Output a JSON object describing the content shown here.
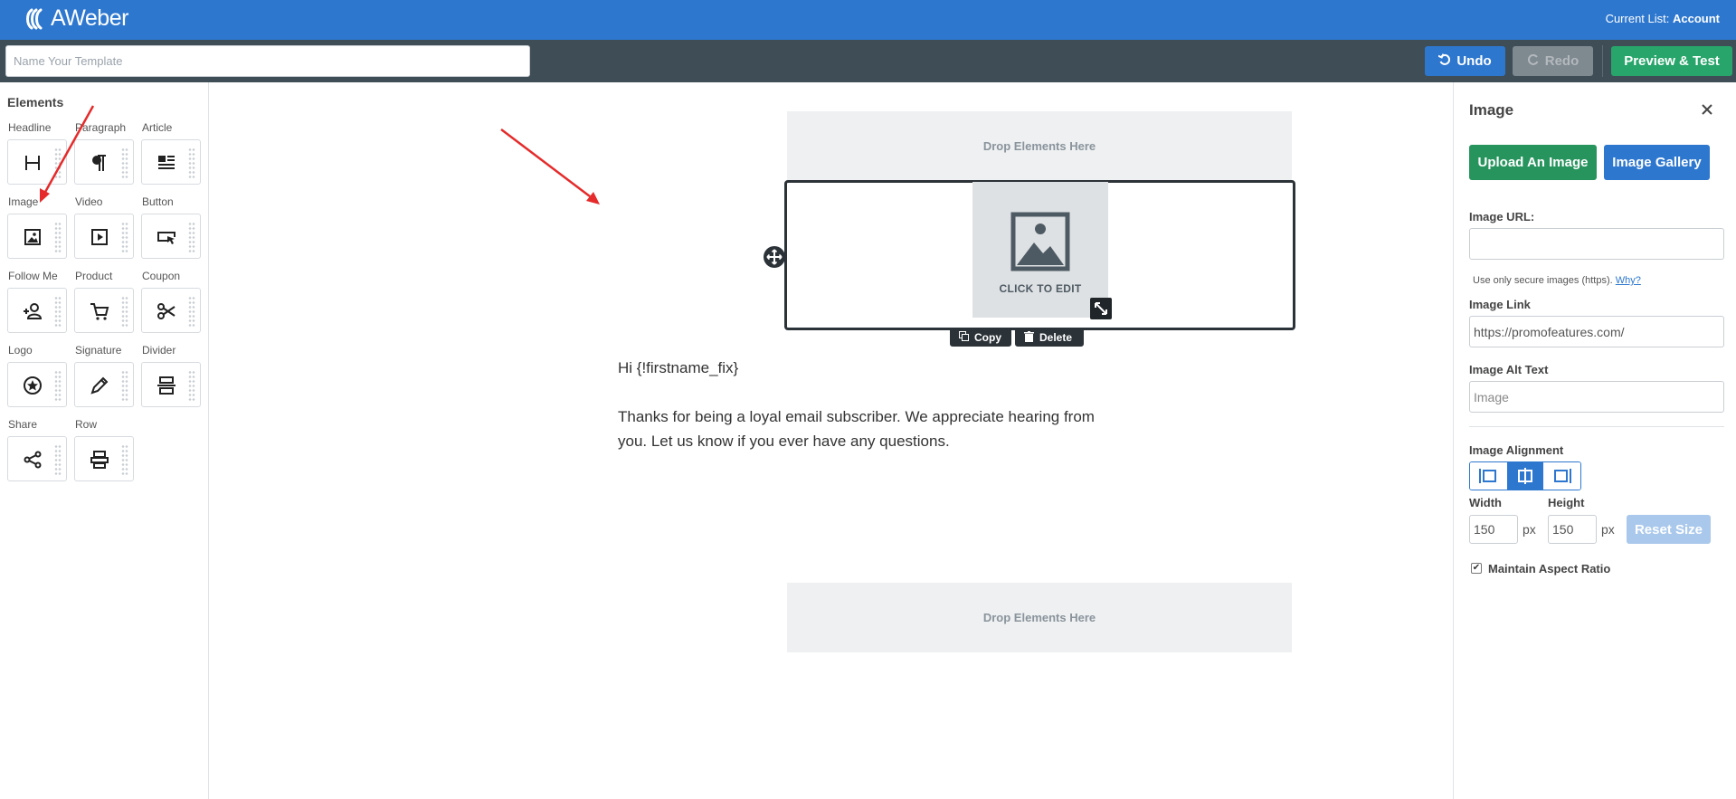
{
  "header": {
    "brand": "AWeber",
    "current_list_label": "Current List:",
    "current_list_value": "Account"
  },
  "toolbar": {
    "template_name_placeholder": "Name Your Template",
    "undo_label": "Undo",
    "redo_label": "Redo",
    "preview_label": "Preview & Test"
  },
  "elements_panel": {
    "title": "Elements",
    "items": [
      {
        "label": "Headline",
        "icon": "headline-icon"
      },
      {
        "label": "Paragraph",
        "icon": "paragraph-icon"
      },
      {
        "label": "Article",
        "icon": "article-icon"
      },
      {
        "label": "Image",
        "icon": "image-icon"
      },
      {
        "label": "Video",
        "icon": "video-icon"
      },
      {
        "label": "Button",
        "icon": "button-icon"
      },
      {
        "label": "Follow Me",
        "icon": "follow-me-icon"
      },
      {
        "label": "Product",
        "icon": "cart-icon"
      },
      {
        "label": "Coupon",
        "icon": "scissors-icon"
      },
      {
        "label": "Logo",
        "icon": "logo-star-icon"
      },
      {
        "label": "Signature",
        "icon": "pen-icon"
      },
      {
        "label": "Divider",
        "icon": "divider-icon"
      },
      {
        "label": "Share",
        "icon": "share-icon"
      },
      {
        "label": "Row",
        "icon": "row-icon"
      }
    ]
  },
  "canvas": {
    "dropzone_top": "Drop Elements Here",
    "dropzone_bottom": "Drop Elements Here",
    "image_placeholder_label": "CLICK TO EDIT",
    "copy_label": "Copy",
    "delete_label": "Delete",
    "greeting": "Hi {!firstname_fix}",
    "body": "Thanks for being a loyal email subscriber. We appreciate hearing from you. Let us know if you ever have any questions."
  },
  "image_panel": {
    "title": "Image",
    "upload_label": "Upload An Image",
    "gallery_label": "Image Gallery",
    "url_label": "Image URL:",
    "url_value": "",
    "secure_note": "Use only secure images (https).",
    "why_link": "Why?",
    "link_label": "Image Link",
    "link_value": "https://promofeatures.com/",
    "alt_label": "Image Alt Text",
    "alt_placeholder": "Image",
    "alignment_label": "Image Alignment",
    "alignment_selected": "center",
    "width_label": "Width",
    "width_value": "150",
    "height_label": "Height",
    "height_value": "150",
    "unit": "px",
    "reset_label": "Reset Size",
    "aspect_label": "Maintain Aspect Ratio",
    "aspect_checked": true
  },
  "colors": {
    "brand_blue": "#2d77cf",
    "toolbar_dark": "#3f4d56",
    "success_green": "#27a56a",
    "annotation_red": "#e52b2b"
  }
}
